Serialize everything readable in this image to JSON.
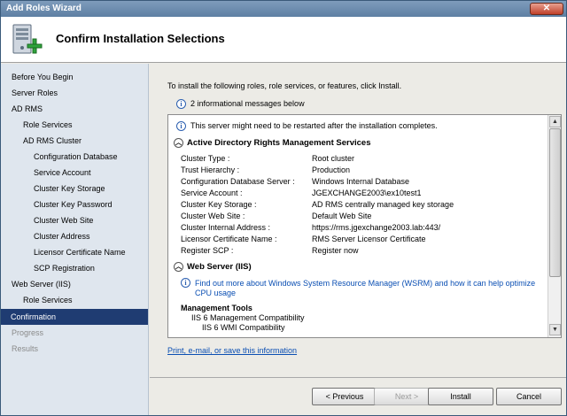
{
  "window": {
    "title": "Add Roles Wizard",
    "close_glyph": "✕"
  },
  "header": {
    "title": "Confirm Installation Selections",
    "icon": "server-roles-add-icon"
  },
  "sidebar": {
    "items": [
      {
        "label": "Before You Begin",
        "state": "normal"
      },
      {
        "label": "Server Roles",
        "state": "normal"
      },
      {
        "label": "AD RMS",
        "state": "normal"
      },
      {
        "label": "Role Services",
        "state": "normal"
      },
      {
        "label": "AD RMS Cluster",
        "state": "normal"
      },
      {
        "label": "Configuration Database",
        "state": "normal"
      },
      {
        "label": "Service Account",
        "state": "normal"
      },
      {
        "label": "Cluster Key Storage",
        "state": "normal"
      },
      {
        "label": "Cluster Key Password",
        "state": "normal"
      },
      {
        "label": "Cluster Web Site",
        "state": "normal"
      },
      {
        "label": "Cluster Address",
        "state": "normal"
      },
      {
        "label": "Licensor Certificate Name",
        "state": "normal"
      },
      {
        "label": "SCP Registration",
        "state": "normal"
      },
      {
        "label": "Web Server (IIS)",
        "state": "normal"
      },
      {
        "label": "Role Services",
        "state": "normal"
      },
      {
        "label": "Confirmation",
        "state": "active"
      },
      {
        "label": "Progress",
        "state": "disabled"
      },
      {
        "label": "Results",
        "state": "disabled"
      }
    ]
  },
  "main": {
    "intro": "To install the following roles, role services, or features, click Install.",
    "info_count": "2 informational messages below",
    "restart_note": "This server might need to be restarted after the installation completes.",
    "adrms": {
      "title": "Active Directory Rights Management Services",
      "rows": [
        {
          "key": "Cluster Type :",
          "value": "Root cluster"
        },
        {
          "key": "Trust Hierarchy :",
          "value": "Production"
        },
        {
          "key": "Configuration Database Server :",
          "value": "Windows Internal Database"
        },
        {
          "key": "Service Account :",
          "value": "JGEXCHANGE2003\\ex10test1"
        },
        {
          "key": "Cluster Key Storage :",
          "value": "AD RMS centrally managed key storage"
        },
        {
          "key": "Cluster Web Site :",
          "value": "Default Web Site"
        },
        {
          "key": "Cluster Internal Address :",
          "value": "https://rms.jgexchange2003.lab:443/"
        },
        {
          "key": "Licensor Certificate Name :",
          "value": "RMS Server Licensor Certificate"
        },
        {
          "key": "Register SCP :",
          "value": "Register now"
        }
      ]
    },
    "iis": {
      "title": "Web Server (IIS)",
      "wsrm_line1": "Find out more about Windows System Resource Manager (WSRM) and how it can help optimize",
      "wsrm_line2": "CPU usage",
      "mgmt_title": "Management Tools",
      "mgmt_items": [
        "IIS 6 Management Compatibility",
        "IIS 6 WMI Compatibility"
      ]
    },
    "print_link": "Print, e-mail, or save this information"
  },
  "buttons": {
    "previous": "< Previous",
    "next": "Next >",
    "install": "Install",
    "cancel": "Cancel"
  }
}
